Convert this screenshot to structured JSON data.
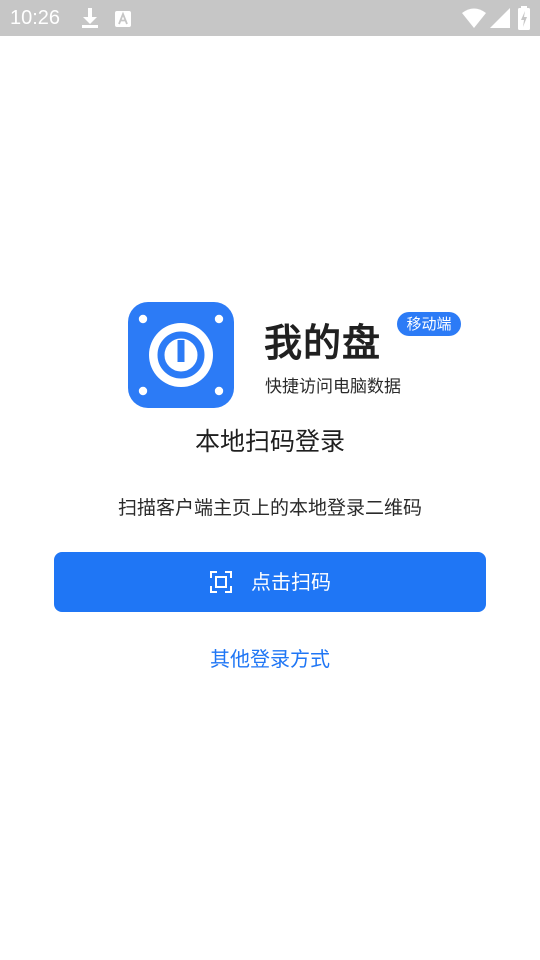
{
  "status_bar": {
    "time": "10:26",
    "icons": [
      "download-icon",
      "a-icon",
      "wifi-icon",
      "signal-icon",
      "battery-charging-icon"
    ]
  },
  "app": {
    "name": "我的盘",
    "badge": "移动端",
    "tagline": "快捷访问电脑数据"
  },
  "login": {
    "heading": "本地扫码登录",
    "instruction": "扫描客户端主页上的本地登录二维码",
    "scan_button_label": "点击扫码",
    "other_methods_link": "其他登录方式"
  },
  "colors": {
    "primary": "#1f76f5",
    "badge": "#2c7bf6",
    "status_bar": "#c6c6c6"
  }
}
